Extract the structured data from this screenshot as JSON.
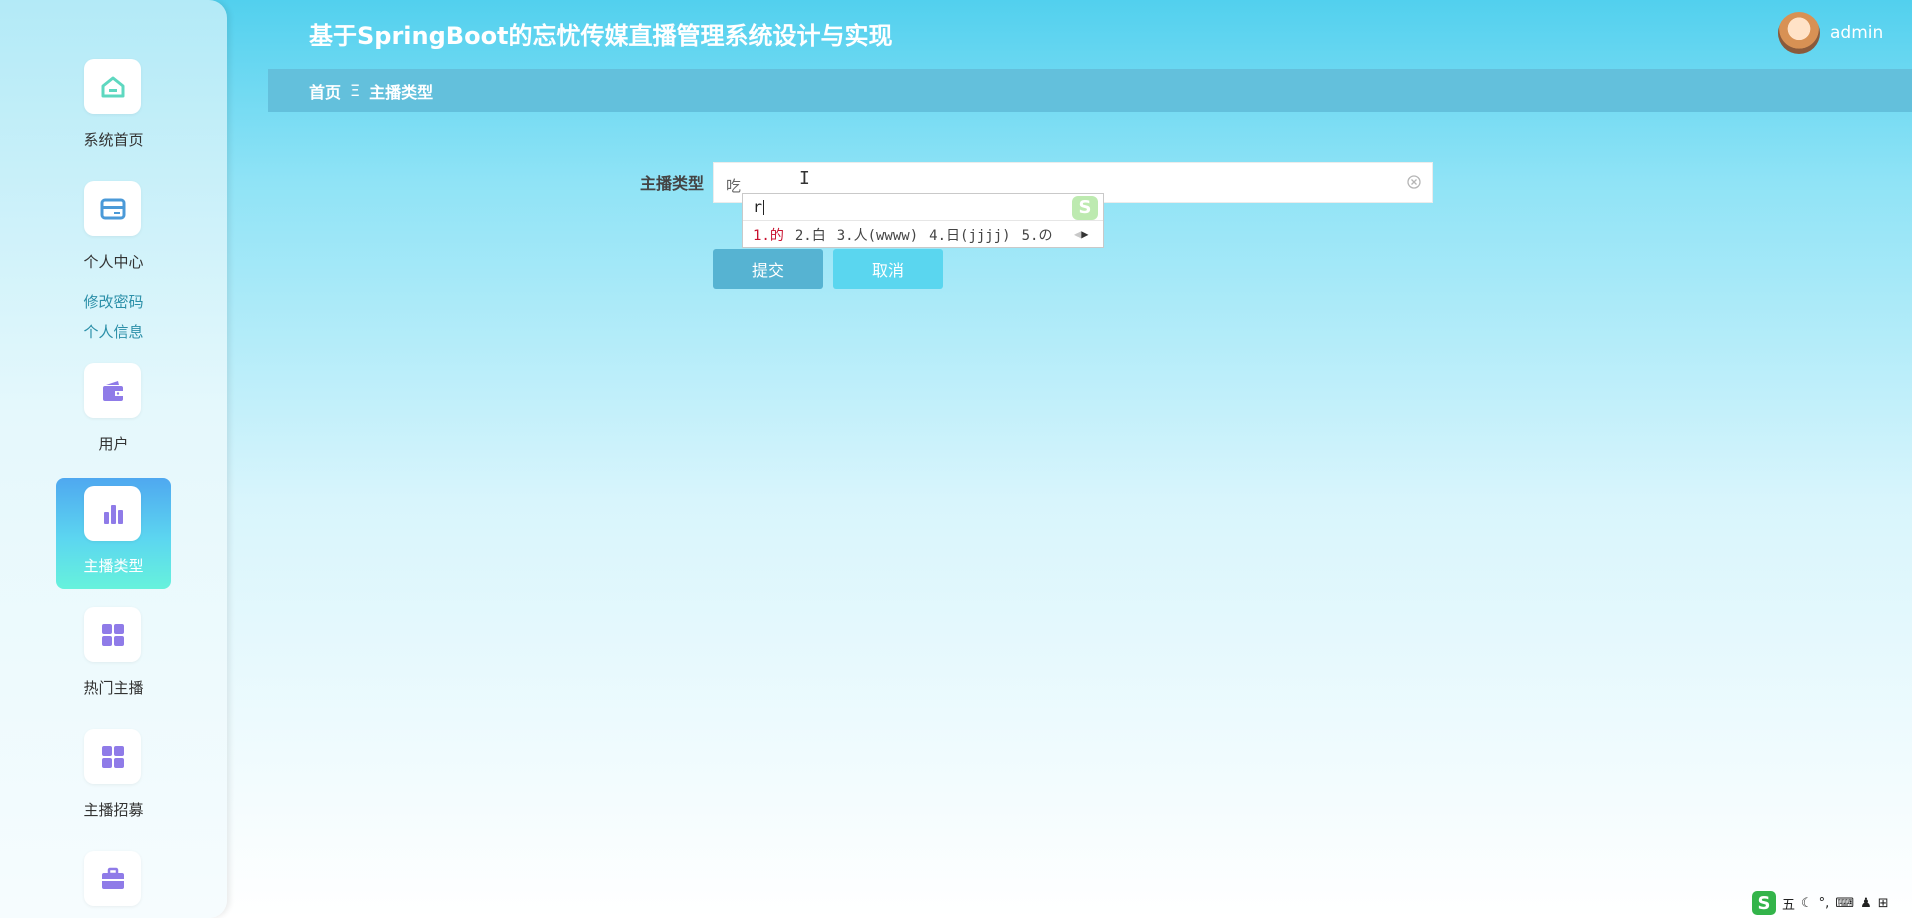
{
  "app": {
    "title": "基于SpringBoot的忘忧传媒直播管理系统设计与实现"
  },
  "user": {
    "name": "admin"
  },
  "breadcrumb": {
    "home": "首页",
    "separator": "Ξ",
    "current": "主播类型"
  },
  "sidebar": {
    "items": [
      {
        "label": "系统首页",
        "icon": "home-icon",
        "color": "#5ed8c0"
      },
      {
        "label": "个人中心",
        "icon": "card-icon",
        "color": "#4b9ad8"
      },
      {
        "label": "用户",
        "icon": "wallet-icon",
        "color": "#8f7be8"
      },
      {
        "label": "主播类型",
        "icon": "bar-chart-icon",
        "color": "#8f7be8",
        "active": true
      },
      {
        "label": "热门主播",
        "icon": "grid-icon",
        "color": "#8f7be8"
      },
      {
        "label": "主播招募",
        "icon": "grid-icon",
        "color": "#8f7be8"
      },
      {
        "label": "",
        "icon": "briefcase-icon",
        "color": "#8f7be8"
      }
    ],
    "submenu": [
      "修改密码",
      "个人信息"
    ]
  },
  "form": {
    "field_label": "主播类型",
    "field_value": "吃",
    "submit_label": "提交",
    "cancel_label": "取消"
  },
  "ime": {
    "input": "r",
    "candidates": [
      "1.的",
      "2.白",
      "3.人(wwww)",
      "4.日(jjjj)",
      "5.の"
    ],
    "logo": "S"
  },
  "status_bar": {
    "logo": "S",
    "mode": "五",
    "items": [
      "moon-icon",
      "punctuation-icon",
      "keyboard-icon",
      "person-icon",
      "grid-icon"
    ]
  },
  "colors": {
    "accent": "#56b3d2",
    "cancel": "#5ad6ef",
    "breadcrumb_bg": "#63c0dc",
    "ime_highlight": "#c8102e"
  }
}
